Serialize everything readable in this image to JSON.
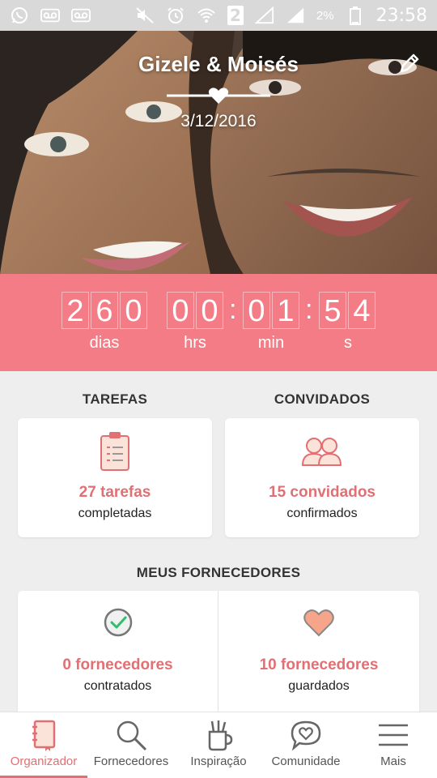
{
  "status_bar": {
    "sim_badge": "2",
    "battery_percent": "2%",
    "time": "23:58",
    "icons": [
      "whatsapp-icon",
      "voicemail-icon",
      "voicemail-icon",
      "mute-icon",
      "alarm-icon",
      "wifi-icon",
      "signal-icon",
      "signal-icon",
      "battery-icon"
    ]
  },
  "hero": {
    "couple_names": "Gizele & Moisés",
    "wedding_date": "3/12/2016"
  },
  "countdown": {
    "days_digits": [
      "2",
      "6",
      "0"
    ],
    "hours_digits": [
      "0",
      "0"
    ],
    "minutes_digits": [
      "0",
      "1"
    ],
    "seconds_digits": [
      "5",
      "4"
    ],
    "separator": ":",
    "units": {
      "days": "dias",
      "hours": "hrs",
      "minutes": "min",
      "seconds": "s"
    }
  },
  "tasks": {
    "title": "TAREFAS",
    "count": "27 tarefas",
    "subtitle": "completadas"
  },
  "guests": {
    "title": "CONVIDADOS",
    "count": "15 convidados",
    "subtitle": "confirmados"
  },
  "vendors": {
    "title": "MEUS FORNECEDORES",
    "hired": {
      "count": "0 fornecedores",
      "subtitle": "contratados"
    },
    "saved": {
      "count": "10 fornecedores",
      "subtitle": "guardados"
    }
  },
  "bottom_nav": {
    "items": [
      {
        "label": "Organizador",
        "icon": "notebook-icon",
        "active": true
      },
      {
        "label": "Fornecedores",
        "icon": "search-icon",
        "active": false
      },
      {
        "label": "Inspiração",
        "icon": "brush-cup-icon",
        "active": false
      },
      {
        "label": "Comunidade",
        "icon": "chat-heart-icon",
        "active": false
      },
      {
        "label": "Mais",
        "icon": "menu-icon",
        "active": false
      }
    ]
  },
  "colors": {
    "accent": "#f37c86",
    "accent_text": "#e07074",
    "background": "#eeeeee"
  }
}
